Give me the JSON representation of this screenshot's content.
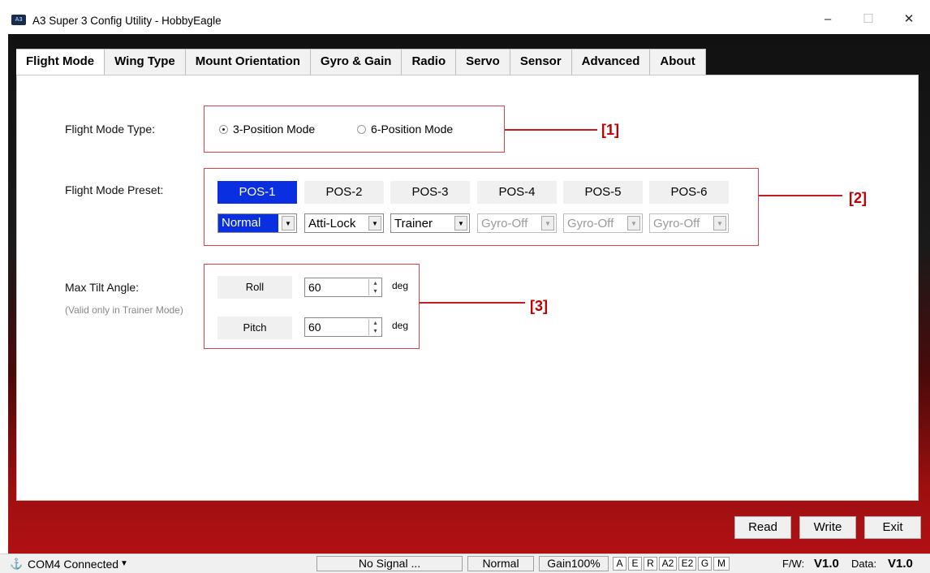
{
  "window": {
    "title": "A3 Super 3 Config Utility - HobbyEagle",
    "app_icon_text": "A3",
    "minimize": "–",
    "maximize": "☐",
    "close": "✕"
  },
  "tabs": [
    "Flight Mode",
    "Wing Type",
    "Mount Orientation",
    "Gyro & Gain",
    "Radio",
    "Servo",
    "Sensor",
    "Advanced",
    "About"
  ],
  "active_tab": "Flight Mode",
  "flight_mode_type": {
    "label": "Flight Mode Type:",
    "options": [
      "3-Position Mode",
      "6-Position Mode"
    ],
    "selected": "3-Position Mode"
  },
  "flight_mode_preset": {
    "label": "Flight Mode Preset:",
    "positions": [
      "POS-1",
      "POS-2",
      "POS-3",
      "POS-4",
      "POS-5",
      "POS-6"
    ],
    "active_position": "POS-1",
    "modes": [
      "Normal",
      "Atti-Lock",
      "Trainer",
      "Gyro-Off",
      "Gyro-Off",
      "Gyro-Off"
    ],
    "enabled_count": 3
  },
  "max_tilt": {
    "label": "Max Tilt Angle:",
    "note": "(Valid only in Trainer Mode)",
    "roll_label": "Roll",
    "roll_value": "60",
    "pitch_label": "Pitch",
    "pitch_value": "60",
    "unit": "deg"
  },
  "callouts": [
    "[1]",
    "[2]",
    "[3]"
  ],
  "buttons": {
    "read": "Read",
    "write": "Write",
    "exit": "Exit"
  },
  "statusbar": {
    "connection": "COM4 Connected",
    "signal": "No Signal ...",
    "mode": "Normal",
    "gain": "Gain100%",
    "channels": [
      "A",
      "E",
      "R",
      "A2",
      "E2",
      "G",
      "M"
    ],
    "fw_label": "F/W:",
    "fw_version": "V1.0",
    "data_label": "Data:",
    "data_version": "V1.0"
  },
  "colors": {
    "accent_blue": "#0a2fe0",
    "callout_red": "#c00000",
    "frame_red": "#b01014"
  }
}
